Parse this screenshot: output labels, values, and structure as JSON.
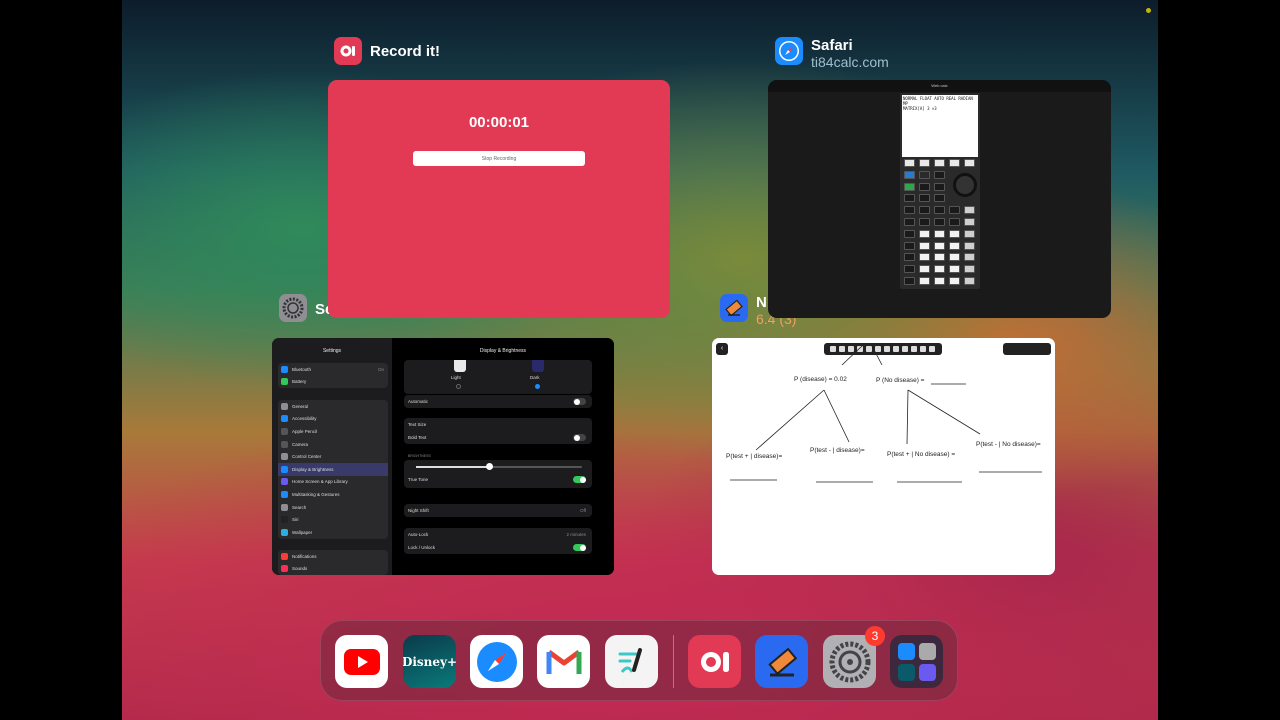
{
  "apps": [
    {
      "name": "Record it!",
      "subtitle": ""
    },
    {
      "name": "Safari",
      "subtitle": "ti84calc.com"
    },
    {
      "name": "Se",
      "subtitle": ""
    },
    {
      "name": "N",
      "subtitle": "6.4 (3)"
    }
  ],
  "record_card": {
    "timer": "00:00:01",
    "button": "Stop Recording"
  },
  "safari_card": {
    "site_bar": "Web calc",
    "calc_line1": "NORMAL FLOAT AUTO REAL RADIAN MP",
    "calc_line2": "MATRIX[A] 3 ×3"
  },
  "settings_card": {
    "sidebar_title": "Settings",
    "main_title": "Display & Brightness",
    "sidebar_top": [
      "Bluetooth",
      "Battery"
    ],
    "bluetooth_value": "On",
    "sidebar_mid": [
      "General",
      "Accessibility",
      "Apple Pencil",
      "Camera",
      "Control Center",
      "Display & Brightness",
      "Home Screen & App Library",
      "Multitasking & Gestures",
      "Search",
      "Siri",
      "Wallpaper"
    ],
    "sidebar_bottom": [
      "Notifications",
      "Sounds"
    ],
    "appearance": [
      "Light",
      "Dark"
    ],
    "automatic": "Automatic",
    "text_size": "Text Size",
    "bold_text": "Bold Text",
    "brightness": "BRIGHTNESS",
    "true_tone": "True Tone",
    "night_shift": "Night Shift",
    "night_shift_value": "Off",
    "auto_lock": "Auto-Lock",
    "auto_lock_value": "2 minutes",
    "lock_unlock": "Lock / Unlock"
  },
  "notes_card": {
    "p_disease": "P (disease) = 0.02",
    "p_no_disease": "P (No disease) =",
    "t1": "P(test + | disease)=",
    "t2": "P(test - | disease)=",
    "t3": "P(test + | No disease) =",
    "t4": "P(test - | No disease)="
  },
  "dock": {
    "apps": [
      "YouTube",
      "Disney+",
      "Safari",
      "Gmail",
      "Freeform",
      "Record it!",
      "Notability",
      "Settings",
      "App Library"
    ],
    "settings_badge": "3"
  },
  "colors": {
    "record_red": "#e23a55",
    "badge_red": "#ff3b30",
    "safari_blue": "#1a8cff"
  }
}
